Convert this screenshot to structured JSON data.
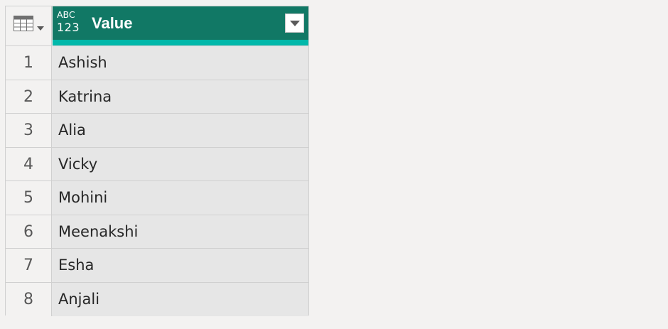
{
  "column": {
    "type_icon": "text-number-type-icon",
    "type_label_top": "ABC",
    "type_label_bottom": "123",
    "name": "Value",
    "header_color": "#117865",
    "quality_color": "#01b8aa"
  },
  "corner": {
    "icon": "table-icon",
    "menu_icon": "dropdown-arrow-icon"
  },
  "rows": [
    {
      "num": "1",
      "value": "Ashish"
    },
    {
      "num": "2",
      "value": "Katrina"
    },
    {
      "num": "3",
      "value": "Alia"
    },
    {
      "num": "4",
      "value": "Vicky"
    },
    {
      "num": "5",
      "value": "Mohini"
    },
    {
      "num": "6",
      "value": "Meenakshi"
    },
    {
      "num": "7",
      "value": "Esha"
    },
    {
      "num": "8",
      "value": "Anjali"
    }
  ]
}
